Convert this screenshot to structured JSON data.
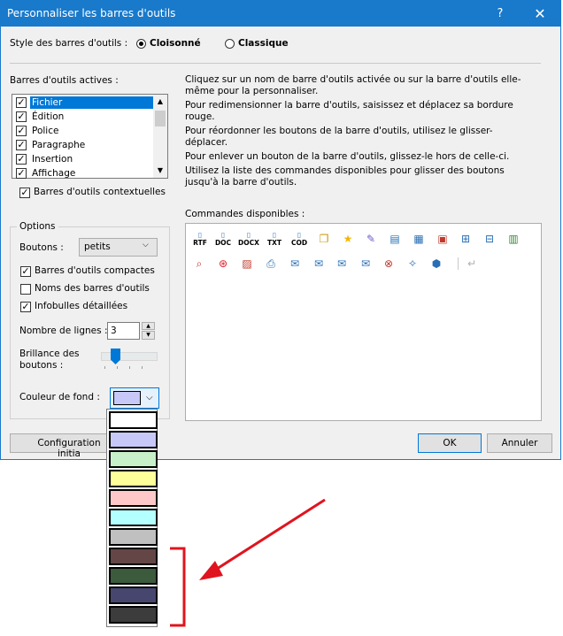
{
  "window": {
    "title": "Personnaliser les barres d'outils",
    "help": "?",
    "close": "✕"
  },
  "style": {
    "label": "Style des barres d'outils :",
    "option1": "Cloisonné",
    "option2": "Classique",
    "selected": "Cloisonné"
  },
  "toolbars": {
    "label": "Barres d'outils actives :",
    "items": [
      {
        "label": "Fichier",
        "checked": true,
        "selected": true
      },
      {
        "label": "Édition",
        "checked": true
      },
      {
        "label": "Police",
        "checked": true
      },
      {
        "label": "Paragraphe",
        "checked": true
      },
      {
        "label": "Insertion",
        "checked": true
      },
      {
        "label": "Affichage",
        "checked": true
      }
    ],
    "contextual": "Barres d'outils contextuelles"
  },
  "help_text": [
    "Cliquez sur un nom de barre d'outils activée ou sur la barre d'outils elle-même pour la personnaliser.",
    "Pour redimensionner la barre d'outils, saisissez et déplacez sa bordure rouge.",
    "Pour réordonner les boutons de la barre d'outils, utilisez le glisser-déplacer.",
    "Pour enlever un bouton de la barre d'outils, glissez-le hors de celle-ci.",
    "Utilisez la liste des commandes disponibles pour glisser des boutons jusqu'à la barre d'outils."
  ],
  "options": {
    "title": "Options",
    "buttons_label": "Boutons :",
    "buttons_value": "petits",
    "compact": "Barres d'outils compactes",
    "names": "Noms des barres d'outils",
    "tooltips": "Infobulles détaillées",
    "lines_label": "Nombre de lignes :",
    "lines_value": "3",
    "brightness_label1": "Brillance des",
    "brightness_label2": "boutons :",
    "brightness_level": 0.25,
    "color_label": "Couleur de fond :"
  },
  "commands": {
    "label": "Commandes disponibles :",
    "text_icons": [
      "RTF",
      "DOC",
      "DOCX",
      "TXT",
      "COD"
    ]
  },
  "colors": {
    "selected": "#c8c8f8",
    "options": [
      "#ffffff",
      "#c8c8f8",
      "#c8f0c8",
      "#ffff99",
      "#ffc8c8",
      "#b4ffff",
      "#c0c0c0",
      "#644646",
      "#3c5a3c",
      "#46466e",
      "#3c3c3c"
    ]
  },
  "buttons": {
    "reset": "Configuration initia",
    "ok": "OK",
    "cancel": "Annuler"
  },
  "annotation": {
    "color": "#e0141e"
  }
}
